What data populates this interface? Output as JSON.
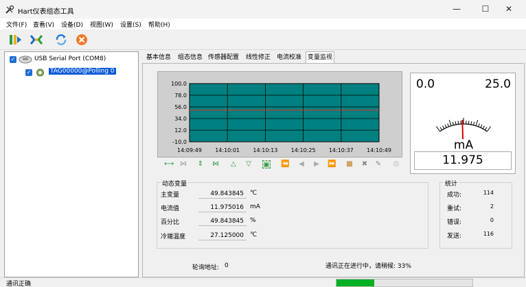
{
  "window": {
    "title": "Hart仪表组态工具",
    "icon": "wrench-icon"
  },
  "menu": [
    "文件(F)",
    "查看(V)",
    "设备(D)",
    "视图(W)",
    "设置(S)",
    "帮助(H)"
  ],
  "toolbar": {
    "buttons": [
      "connect-icon",
      "search-device-icon",
      "refresh-icon",
      "stop-icon"
    ]
  },
  "tree": {
    "root_label": "USB Serial Port (COM8)",
    "child_label": "TAG00000@Polling 0"
  },
  "tabs": [
    "基本信息",
    "组态信息",
    "传感器配置",
    "线性修正",
    "电流校准",
    "变量监视"
  ],
  "active_tab": "变量监视",
  "chart_data": {
    "type": "line",
    "y_ticks": [
      "100.0",
      "78.0",
      "56.0",
      "34.0",
      "12.0",
      "-10.0"
    ],
    "x_ticks": [
      "14:09:49",
      "14:10:01",
      "14:10:13",
      "14:10:25",
      "14:10:37",
      "14:10:49"
    ],
    "ylim": [
      -10.0,
      100.0
    ],
    "series": [
      {
        "values": [
          49.84,
          49.84,
          49.84,
          49.84,
          49.84,
          49.84
        ],
        "color": "#ff2a2a"
      }
    ],
    "plot_bg": "#008080",
    "grid": true
  },
  "gauge": {
    "min": "0.0",
    "max": "25.0",
    "unit": "mA",
    "value": "11.975",
    "value_num": 11.975
  },
  "dynamic_vars": {
    "title": "动态变量",
    "rows": [
      {
        "label": "主变量",
        "value": "49.843845",
        "unit": "℃"
      },
      {
        "label": "电流值",
        "value": "11.975016",
        "unit": "mA"
      },
      {
        "label": "百分比",
        "value": "49.843845",
        "unit": "%"
      },
      {
        "label": "冷端温度",
        "value": "27.125000",
        "unit": "℃"
      }
    ]
  },
  "stats": {
    "title": "统计",
    "rows": [
      {
        "label": "成功:",
        "value": "114"
      },
      {
        "label": "重试:",
        "value": "2"
      },
      {
        "label": "错误:",
        "value": "0"
      },
      {
        "label": "发送:",
        "value": "116"
      }
    ]
  },
  "poll": {
    "address_label": "轮询地址:",
    "address_value": "0",
    "progress_text": "通讯正在进行中，请稍候: 33%"
  },
  "status": {
    "text": "通讯正确",
    "progress": 0.28
  }
}
